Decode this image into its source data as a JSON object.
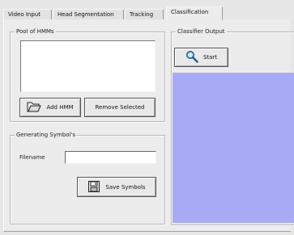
{
  "tabs": [
    {
      "label": "Video Input"
    },
    {
      "label": "Head Segmentation"
    },
    {
      "label": "Tracking"
    },
    {
      "label": "Classification"
    }
  ],
  "pool": {
    "title": "Pool of HMMs",
    "add_label": "Add HMM",
    "remove_label": "Remove Selected"
  },
  "generating": {
    "title": "Generating Symbol's",
    "filename_label": "Filename",
    "filename_value": "",
    "save_label": "Save Symbols"
  },
  "classifier": {
    "title": "Classifier Output",
    "start_label": "Start"
  },
  "colors": {
    "output_background": "#a9aaf6"
  },
  "icons": {
    "add": "folder-open-icon",
    "save": "disk-save-icon",
    "start": "magnifier-icon"
  }
}
